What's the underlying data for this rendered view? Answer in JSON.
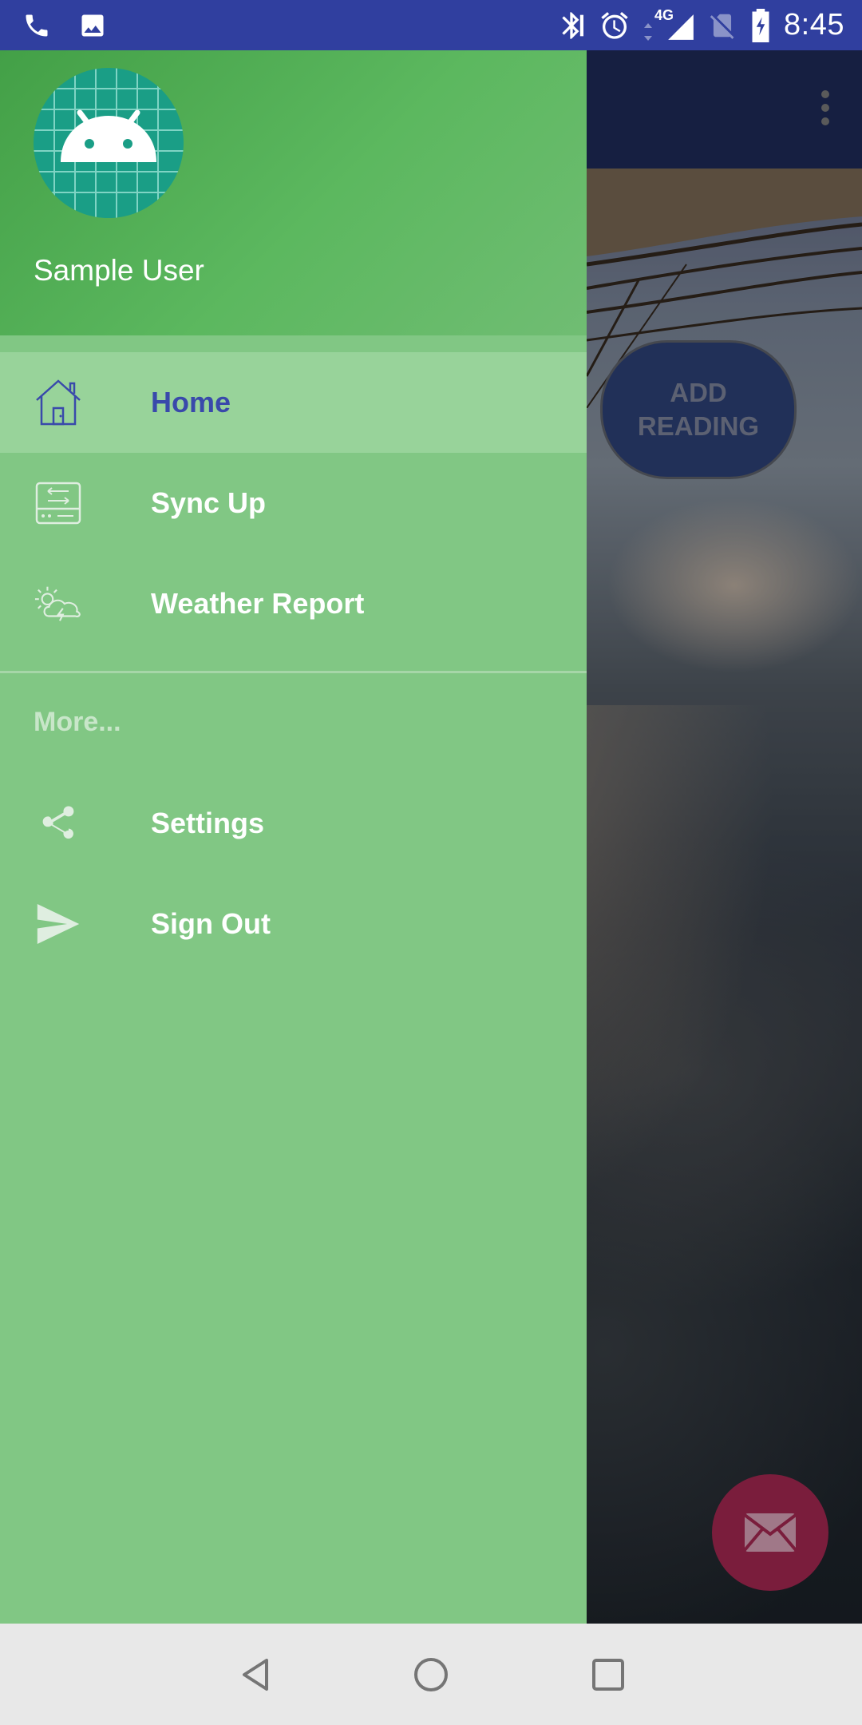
{
  "status_bar": {
    "time": "8:45",
    "network": "4G",
    "left_icons": [
      "phone-icon",
      "image-icon"
    ],
    "right_icons": [
      "bluetooth-icon",
      "alarm-icon",
      "signal-icon",
      "no-sim-icon",
      "battery-icon"
    ]
  },
  "drawer": {
    "header": {
      "user_name": "Sample User",
      "avatar_icon": "android-icon"
    },
    "items": [
      {
        "label": "Home",
        "icon": "home-icon",
        "selected": true
      },
      {
        "label": "Sync Up",
        "icon": "sync-icon",
        "selected": false
      },
      {
        "label": "Weather Report",
        "icon": "weather-icon",
        "selected": false
      }
    ],
    "more_header": "More...",
    "more_items": [
      {
        "label": "Settings",
        "icon": "share-icon"
      },
      {
        "label": "Sign Out",
        "icon": "send-icon"
      }
    ]
  },
  "app": {
    "add_reading_label": "ADD READING",
    "fab_icon": "mail-icon"
  },
  "colors": {
    "status_bar": "#303f9f",
    "drawer_bg": "#81c784",
    "header_green": "#4caf50",
    "selected_text": "#3949ab",
    "fab": "#7a1d3c"
  },
  "nav_bar": {
    "buttons": [
      "back-icon",
      "home-circle-icon",
      "recents-icon"
    ]
  }
}
